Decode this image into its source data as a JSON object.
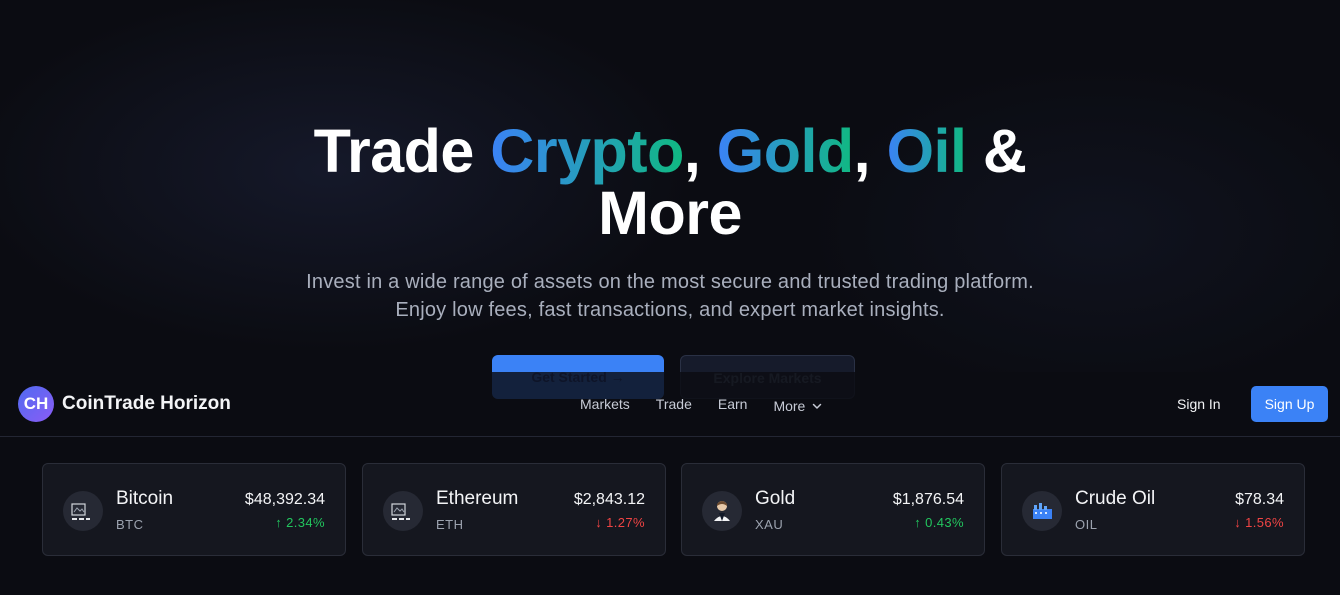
{
  "hero": {
    "title_part1": "Trade ",
    "title_crypto": "Crypto",
    "title_comma1": ", ",
    "title_gold": "Gold",
    "title_comma2": ", ",
    "title_oil": "Oil",
    "title_part2": " & More",
    "subtitle": "Invest in a wide range of assets on the most secure and trusted trading platform. Enjoy low fees, fast transactions, and expert market insights.",
    "cta_primary": "Get Started →",
    "cta_secondary": "Explore Markets"
  },
  "navbar": {
    "logo_initials": "CH",
    "brand": "CoinTrade Horizon",
    "links": [
      "Markets",
      "Trade",
      "Earn",
      "More"
    ],
    "sign_in": "Sign In",
    "sign_up": "Sign Up"
  },
  "tickers": [
    {
      "name": "Bitcoin",
      "symbol": "BTC",
      "price": "$48,392.34",
      "change": "↑ 2.34%",
      "direction": "up",
      "icon": "bitcoin-icon"
    },
    {
      "name": "Ethereum",
      "symbol": "ETH",
      "price": "$2,843.12",
      "change": "↓ 1.27%",
      "direction": "down",
      "icon": "ethereum-icon"
    },
    {
      "name": "Gold",
      "symbol": "XAU",
      "price": "$1,876.54",
      "change": "↑ 0.43%",
      "direction": "up",
      "icon": "gold-icon"
    },
    {
      "name": "Crude Oil",
      "symbol": "OIL",
      "price": "$78.34",
      "change": "↓ 1.56%",
      "direction": "down",
      "icon": "oil-icon"
    }
  ],
  "colors": {
    "accent": "#3b82f6",
    "gradient_start": "#3b82f6",
    "gradient_end": "#10b981",
    "positive": "#22c55e",
    "negative": "#ef4444"
  }
}
